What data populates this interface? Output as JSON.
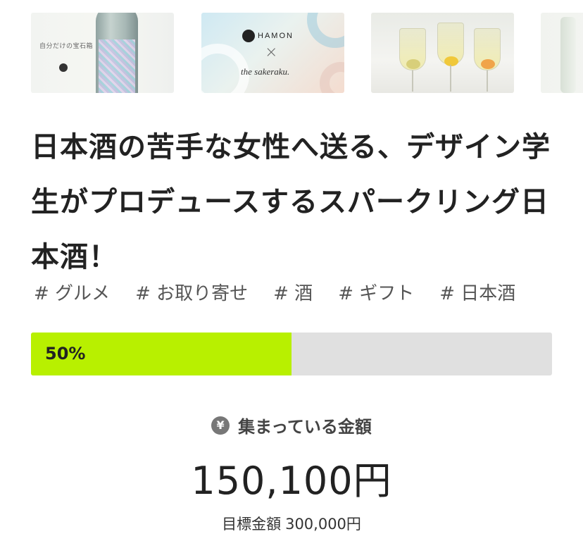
{
  "gallery": {
    "thumb1_caption": "自分だけの宝石箱",
    "thumb2_brand": "HAMON",
    "thumb2_cross": "×",
    "thumb2_partner": "the sakeraku."
  },
  "project": {
    "title": "日本酒の苦手な女性へ送る、デザイン学生がプロデュースするスパークリング日本酒！",
    "tags": [
      "# グルメ",
      "# お取り寄せ",
      "# 酒",
      "# ギフト",
      "# 日本酒"
    ]
  },
  "funding": {
    "progress_percent": 50,
    "progress_label": "50%",
    "collected_label": "集まっている金額",
    "collected_amount": "150,100円",
    "goal_label": "目標金額",
    "goal_amount": "300,000円"
  },
  "icons": {
    "yen_icon": "yen-circle-icon",
    "yen_glyph": "¥"
  },
  "colors": {
    "progress_fill": "#b8f000",
    "progress_track": "#e0e0e0"
  }
}
